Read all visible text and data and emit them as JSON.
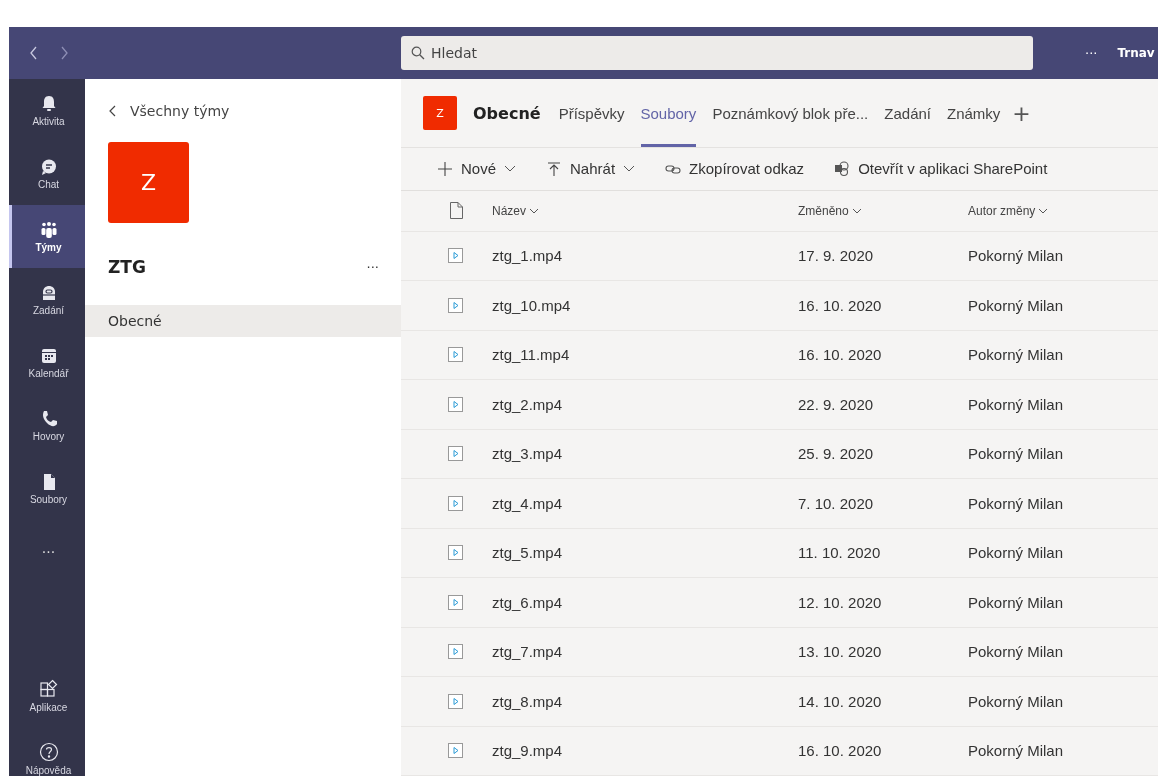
{
  "top_bar": {
    "search": {
      "placeholder": "Hledat"
    },
    "more": "···",
    "user": "Trnav"
  },
  "rail": [
    {
      "kind": "bell",
      "label": "Aktivita",
      "selected": false
    },
    {
      "kind": "chat",
      "label": "Chat",
      "selected": false
    },
    {
      "kind": "teams",
      "label": "Týmy",
      "selected": true
    },
    {
      "kind": "bag",
      "label": "Zadání",
      "selected": false
    },
    {
      "kind": "calendar",
      "label": "Kalendář",
      "selected": false
    },
    {
      "kind": "phone",
      "label": "Hovory",
      "selected": false
    },
    {
      "kind": "file",
      "label": "Soubory",
      "selected": false
    },
    {
      "kind": "more",
      "label": "···",
      "selected": false
    }
  ],
  "rail_bottom": [
    {
      "kind": "apps",
      "label": "Aplikace"
    },
    {
      "kind": "help",
      "label": "Nápověda"
    }
  ],
  "team_pane": {
    "back": "Všechny týmy",
    "avatar": "Z",
    "name": "ZTG",
    "more": "···",
    "channels": [
      {
        "label": "Obecné",
        "selected": true
      }
    ]
  },
  "channel": {
    "avatar": "Z",
    "name": "Obecné",
    "tabs": [
      {
        "label": "Příspěvky",
        "selected": false
      },
      {
        "label": "Soubory",
        "selected": true
      },
      {
        "label": "Poznámkový blok pře...",
        "selected": false
      },
      {
        "label": "Zadání",
        "selected": false
      },
      {
        "label": "Známky",
        "selected": false
      }
    ],
    "add": "+"
  },
  "toolbar": [
    {
      "kind": "plus",
      "label": "Nové",
      "dropdown": true
    },
    {
      "kind": "upload",
      "label": "Nahrát",
      "dropdown": true
    },
    {
      "kind": "link",
      "label": "Zkopírovat odkaz",
      "dropdown": false
    },
    {
      "kind": "sharepoint",
      "label": "Otevřít v aplikaci SharePoint",
      "dropdown": false
    }
  ],
  "table": {
    "columns": [
      "Název",
      "Změněno",
      "Autor změny"
    ],
    "rows": [
      {
        "name": "ztg_1.mp4",
        "modified": "17. 9. 2020",
        "author": "Pokorný Milan"
      },
      {
        "name": "ztg_10.mp4",
        "modified": "16. 10. 2020",
        "author": "Pokorný Milan"
      },
      {
        "name": "ztg_11.mp4",
        "modified": "16. 10. 2020",
        "author": "Pokorný Milan"
      },
      {
        "name": "ztg_2.mp4",
        "modified": "22. 9. 2020",
        "author": "Pokorný Milan"
      },
      {
        "name": "ztg_3.mp4",
        "modified": "25. 9. 2020",
        "author": "Pokorný Milan"
      },
      {
        "name": "ztg_4.mp4",
        "modified": "7. 10. 2020",
        "author": "Pokorný Milan"
      },
      {
        "name": "ztg_5.mp4",
        "modified": "11. 10. 2020",
        "author": "Pokorný Milan"
      },
      {
        "name": "ztg_6.mp4",
        "modified": "12. 10. 2020",
        "author": "Pokorný Milan"
      },
      {
        "name": "ztg_7.mp4",
        "modified": "13. 10. 2020",
        "author": "Pokorný Milan"
      },
      {
        "name": "ztg_8.mp4",
        "modified": "14. 10. 2020",
        "author": "Pokorný Milan"
      },
      {
        "name": "ztg_9.mp4",
        "modified": "16. 10. 2020",
        "author": "Pokorný Milan"
      }
    ]
  }
}
